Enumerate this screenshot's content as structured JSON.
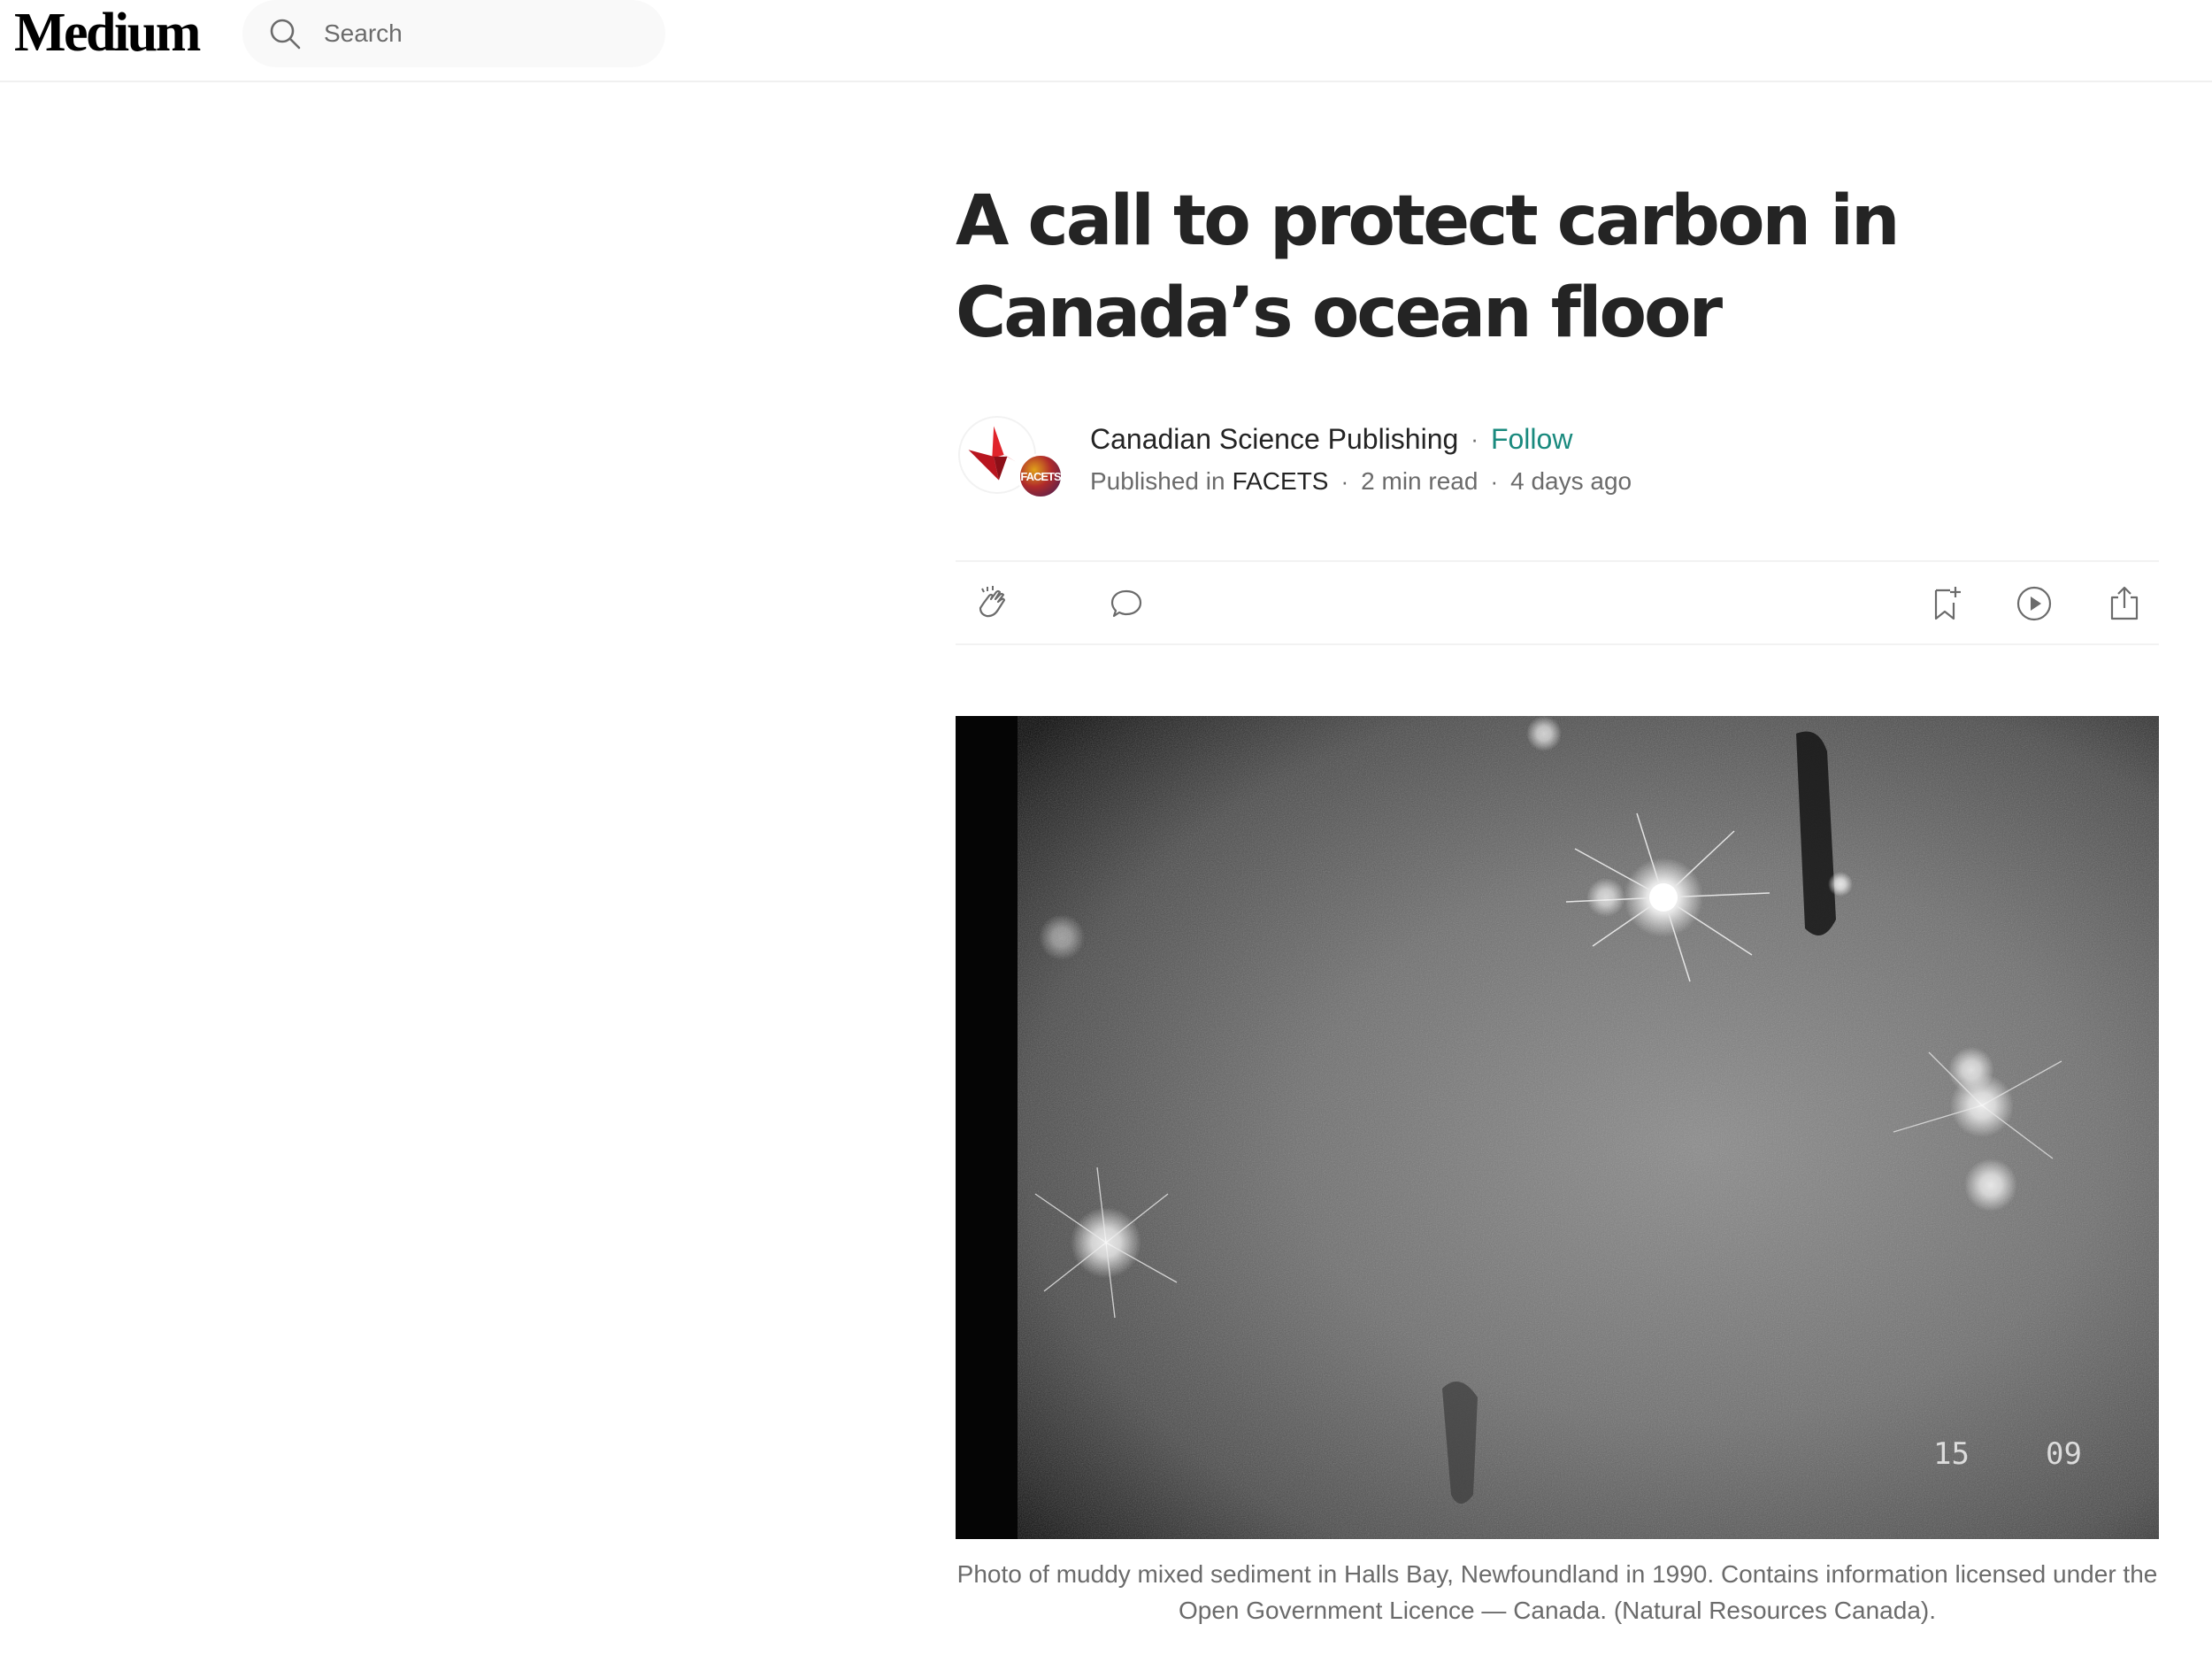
{
  "header": {
    "logo": "Medium",
    "search": {
      "placeholder": "Search",
      "value": ""
    }
  },
  "article": {
    "title": "A call to protect carbon in Canada’s ocean floor",
    "author": "Canadian Science Publishing",
    "follow_label": "Follow",
    "published_in_label": "Published in",
    "publication": "FACETS",
    "read_time": "2 min read",
    "date": "4 days ago",
    "badge_text": "FACETS",
    "hero_overlay": {
      "left_digits": "15",
      "right_digits": "09"
    },
    "caption": "Photo of muddy mixed sediment in Halls Bay, Newfoundland in 1990. Contains information licensed under the Open Government Licence — Canada. (Natural Resources Canada)."
  },
  "colors": {
    "follow": "#1a8a7e",
    "text": "#242424",
    "muted": "#6b6b6b"
  },
  "icons": [
    "search-icon",
    "clap-icon",
    "comment-icon",
    "bookmark-add-icon",
    "listen-play-icon",
    "share-icon"
  ]
}
